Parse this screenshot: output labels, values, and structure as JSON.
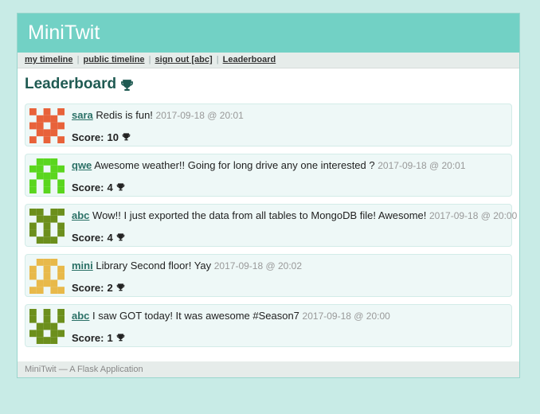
{
  "app": {
    "title": "MiniTwit"
  },
  "nav": {
    "my_timeline": "my timeline",
    "public_timeline": "public timeline",
    "sign_out": "sign out [abc]",
    "leaderboard": "Leaderboard",
    "separator": "|"
  },
  "page": {
    "heading": "Leaderboard"
  },
  "posts": [
    {
      "user": "sara",
      "text": "Redis is fun!",
      "time": "2017-09-18 @ 20:01",
      "score_label": "Score:",
      "score": "10",
      "avatar_color": "#e8623a"
    },
    {
      "user": "qwe",
      "text": "Awesome weather!! Going for long drive any one interested ?",
      "time": "2017-09-18 @ 20:01",
      "score_label": "Score:",
      "score": "4",
      "avatar_color": "#5ad61e"
    },
    {
      "user": "abc",
      "text": "Wow!! I just exported the data from all tables to MongoDB file! Awesome!",
      "time": "2017-09-18 @ 20:00",
      "score_label": "Score:",
      "score": "4",
      "avatar_color": "#6c8f1c"
    },
    {
      "user": "mini",
      "text": "Library Second floor! Yay",
      "time": "2017-09-18 @ 20:02",
      "score_label": "Score:",
      "score": "2",
      "avatar_color": "#e8b94a"
    },
    {
      "user": "abc",
      "text": "I saw GOT today! It was awesome #Season7",
      "time": "2017-09-18 @ 20:00",
      "score_label": "Score:",
      "score": "1",
      "avatar_color": "#6c8f1c"
    }
  ],
  "footer": {
    "text": "MiniTwit — A Flask Application"
  },
  "icons": {
    "trophy": "trophy-icon"
  }
}
